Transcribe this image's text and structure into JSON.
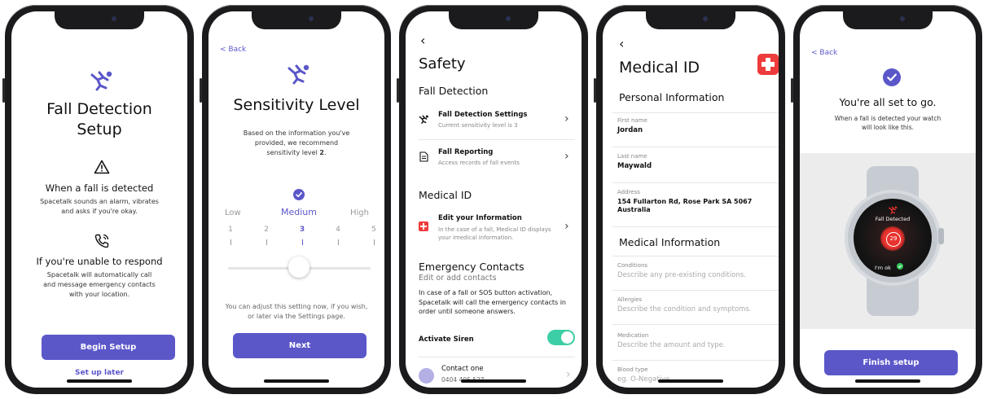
{
  "screen1": {
    "title_line1": "Fall Detection",
    "title_line2": "Setup",
    "section1_title": "When a fall is detected",
    "section1_text_line1": "Spacetalk sounds an alarm, vibrates",
    "section1_text_line2": "and asks if you're okay.",
    "section2_title": "If you're unable to respond",
    "section2_text_line1": "Spacetalk will automatically call",
    "section2_text_line2": "and message emergency contacts",
    "section2_text_line3": "with your location.",
    "primary_button": "Begin Setup",
    "secondary_link": "Set up later"
  },
  "screen2": {
    "back_label": "< Back",
    "title": "Sensitivity Level",
    "desc_line1": "Based on the information you've",
    "desc_line2": "provided, we recommend",
    "desc_line3_prefix": "sensitivity level ",
    "desc_level": "2",
    "desc_line3_suffix": ".",
    "low_label": "Low",
    "medium_label": "Medium",
    "high_label": "High",
    "levels": [
      "1",
      "2",
      "3",
      "4",
      "5"
    ],
    "selected_level": 3,
    "footer_line1": "You can adjust this setting now, if you wish,",
    "footer_line2": "or later via the Settings page.",
    "next_button": "Next"
  },
  "screen3": {
    "back_glyph": "‹",
    "title": "Safety",
    "fall_section": "Fall Detection",
    "item1_title": "Fall Detection Settings",
    "item1_sub": "Current sensitivity level is 3",
    "item2_title": "Fall Reporting",
    "item2_sub": "Access records of fall events",
    "medical_section": "Medical ID",
    "item3_title": "Edit your Information",
    "item3_sub_line1": "In the case of a fall, Medical ID displays",
    "item3_sub_line2": "your imedical information.",
    "emergency_section": "Emergency Contacts",
    "emergency_sub": "Edit or add contacts",
    "emergency_text_line1": "In case of a fall or SOS button activation,",
    "emergency_text_line2": "Spacetalk will call the emergency contacts in",
    "emergency_text_line3": "order until someone answers.",
    "siren_label": "Activate Siren",
    "siren_on": true,
    "contact_name": "Contact one",
    "contact_phone": "0404 405 527"
  },
  "screen4": {
    "back_glyph": "‹",
    "title": "Medical ID",
    "personal_section": "Personal Information",
    "first_name_label": "First name",
    "first_name_value": "Jordan",
    "last_name_label": "Last name",
    "last_name_value": "Maywald",
    "address_label": "Address",
    "address_line1": "154 Fullarton Rd, Rose Park SA 5067",
    "address_line2": "Australia",
    "medical_section": "Medical Information",
    "conditions_label": "Conditions",
    "conditions_placeholder": "Describe any pre-existing conditions.",
    "allergies_label": "Allergies",
    "allergies_placeholder": "Describe the condition and symptoms.",
    "medication_label": "Medication",
    "medication_placeholder": "Describe the amount and type.",
    "blood_label": "Blood type",
    "blood_placeholder": "eg. O-Negative."
  },
  "screen5": {
    "back_label": "< Back",
    "title": "You're all set to go.",
    "desc_line1": "When a fall is detected your watch",
    "desc_line2": "will look like this.",
    "watch_alert": "Fall Detected",
    "watch_countdown": "29",
    "watch_ok": "I'm ok",
    "finish_button": "Finish setup"
  },
  "colors": {
    "accent": "#5b57c9",
    "toggle_on": "#3ccfa5",
    "medical_red": "#ee3b3b",
    "watch_red": "#e8332e",
    "ok_green": "#34c759"
  },
  "icons": {
    "fall": "fall-person-icon",
    "warning": "warning-triangle-icon",
    "phone": "phone-call-icon",
    "check": "check-circle-icon",
    "document": "document-icon",
    "medical": "medical-cross-icon",
    "chevron": "chevron-right-icon"
  }
}
